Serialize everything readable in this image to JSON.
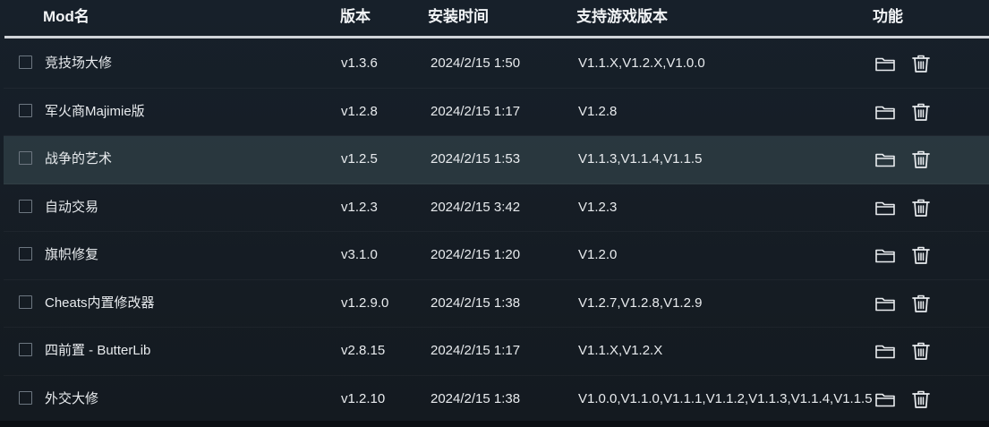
{
  "header": {
    "name": "Mod名",
    "version": "版本",
    "install_time": "安装时间",
    "supported_versions": "支持游戏版本",
    "functions": "功能"
  },
  "icons": {
    "folder": "folder-open-icon",
    "trash": "trash-icon"
  },
  "rows": [
    {
      "name": "竞技场大修",
      "version": "v1.3.6",
      "install_time": "2024/2/15 1:50",
      "supported_versions": "V1.1.X,V1.2.X,V1.0.0"
    },
    {
      "name": "军火商Majimie版",
      "version": "v1.2.8",
      "install_time": "2024/2/15 1:17",
      "supported_versions": "V1.2.8"
    },
    {
      "name": "战争的艺术",
      "version": "v1.2.5",
      "install_time": "2024/2/15 1:53",
      "supported_versions": "V1.1.3,V1.1.4,V1.1.5"
    },
    {
      "name": "自动交易",
      "version": "v1.2.3",
      "install_time": "2024/2/15 3:42",
      "supported_versions": "V1.2.3"
    },
    {
      "name": "旗帜修复",
      "version": "v3.1.0",
      "install_time": "2024/2/15 1:20",
      "supported_versions": "V1.2.0"
    },
    {
      "name": "Cheats内置修改器",
      "version": "v1.2.9.0",
      "install_time": "2024/2/15 1:38",
      "supported_versions": "V1.2.7,V1.2.8,V1.2.9"
    },
    {
      "name": "四前置 - ButterLib",
      "version": "v2.8.15",
      "install_time": "2024/2/15 1:17",
      "supported_versions": "V1.1.X,V1.2.X"
    },
    {
      "name": "外交大修",
      "version": "v1.2.10",
      "install_time": "2024/2/15 1:38",
      "supported_versions": "V1.0.0,V1.1.0,V1.1.1,V1.1.2,V1.1.3,V1.1.4,V1.1.5"
    }
  ],
  "highlighted_row_index": 2,
  "colors": {
    "background": "#161c22",
    "row_highlight": "#2f3d43",
    "header_line": "#d0d4d8",
    "text": "#e8ebee"
  }
}
